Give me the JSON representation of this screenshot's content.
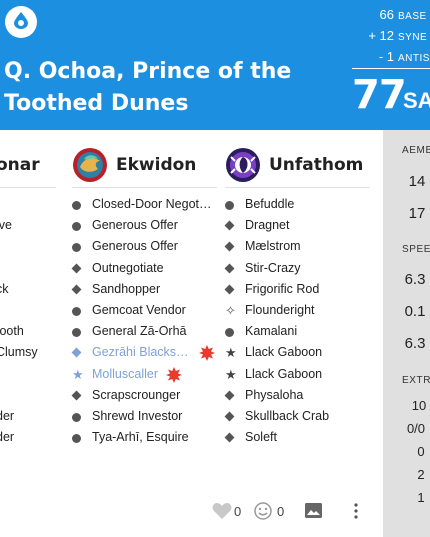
{
  "header": {
    "title": "Q. Ochoa, Prince of the Toothed Dunes",
    "scores": [
      {
        "value": "66",
        "label": "BASE"
      },
      {
        "value": "+ 12",
        "label": "SYNE"
      },
      {
        "value": "- 1",
        "label": "ANTIS"
      }
    ],
    "total": "77",
    "total_label": "SA"
  },
  "columns": {
    "left": {
      "name": "onar",
      "items": [
        "",
        "ive",
        "",
        "",
        "ck",
        "",
        "tooth",
        "Clumsy",
        "",
        "",
        "der",
        "der"
      ]
    },
    "middle": {
      "name": "Ekwidon",
      "items": [
        {
          "marker": "circle",
          "label": "Closed-Door Negot…"
        },
        {
          "marker": "circle",
          "label": "Generous Offer"
        },
        {
          "marker": "circle",
          "label": "Generous Offer"
        },
        {
          "marker": "diamond",
          "label": "Outnegotiate"
        },
        {
          "marker": "diamond",
          "label": "Sandhopper"
        },
        {
          "marker": "circle",
          "label": "Gemcoat Vendor"
        },
        {
          "marker": "circle",
          "label": "General Zā-Orhā"
        },
        {
          "marker": "diamond",
          "label": "Gezrāhi Blacks…",
          "disabled": true,
          "flag": true
        },
        {
          "marker": "star",
          "label": "Molluscaller",
          "disabled": true,
          "flag": true
        },
        {
          "marker": "diamond",
          "label": "Scrapscrounger"
        },
        {
          "marker": "circle",
          "label": "Shrewd Investor"
        },
        {
          "marker": "circle",
          "label": "Tya-Arhī, Esquire"
        }
      ]
    },
    "right": {
      "name": "Unfathom",
      "items": [
        {
          "marker": "circle",
          "label": "Befuddle"
        },
        {
          "marker": "diamond",
          "label": "Dragnet"
        },
        {
          "marker": "diamond",
          "label": "Mælstrom"
        },
        {
          "marker": "diamond",
          "label": "Stir-Crazy"
        },
        {
          "marker": "diamond",
          "label": "Frigorific Rod"
        },
        {
          "marker": "sparkle",
          "label": "Flounderight"
        },
        {
          "marker": "circle",
          "label": "Kamalani"
        },
        {
          "marker": "star",
          "label": "Llack Gaboon"
        },
        {
          "marker": "star",
          "label": "Llack Gaboon"
        },
        {
          "marker": "diamond",
          "label": "Physaloha"
        },
        {
          "marker": "diamond",
          "label": "Skullback Crab"
        },
        {
          "marker": "diamond",
          "label": "Soleft"
        }
      ]
    }
  },
  "footer": {
    "likes": "0",
    "reactions": "0"
  },
  "right_panel": {
    "section1": "AEMB",
    "section1_values": [
      "14",
      "17"
    ],
    "section2": "SPEE",
    "section2_values": [
      "6.3",
      "0.1",
      "6.3"
    ],
    "section3": "EXTR",
    "section3_values": [
      "10",
      "0/0",
      "0",
      "2",
      "1"
    ]
  },
  "colors": {
    "header": "#1d8fe0",
    "disabled_text": "#7fa2d6",
    "flag": "#e63b2e",
    "panel": "#e0e0e0"
  }
}
